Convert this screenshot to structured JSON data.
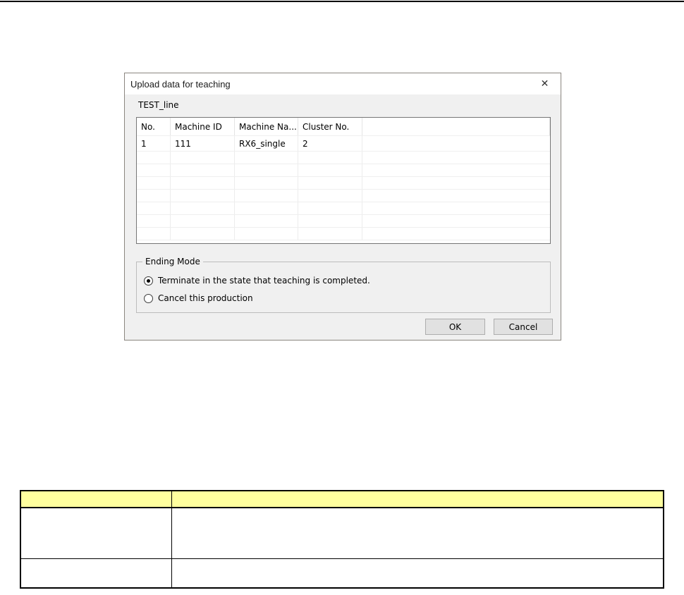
{
  "dialog": {
    "title": "Upload data for teaching",
    "close_icon": "✕",
    "line_name": "TEST_line",
    "machine_table": {
      "columns": [
        "No.",
        "Machine ID",
        "Machine Na...",
        "Cluster No.",
        ""
      ],
      "rows": [
        [
          "1",
          "111",
          "RX6_single",
          "2",
          ""
        ]
      ],
      "empty_row_count": 7
    },
    "ending_mode": {
      "legend": "Ending Mode",
      "options": [
        {
          "label": "Terminate in the state that teaching is completed.",
          "selected": true
        },
        {
          "label": "Cancel this production",
          "selected": false
        }
      ]
    },
    "ok_label": "OK",
    "cancel_label": "Cancel"
  },
  "doc_table": {
    "header": [
      "",
      ""
    ],
    "rows": [
      [
        "",
        ""
      ],
      [
        "",
        ""
      ]
    ],
    "header_bg": "#ffff9e"
  },
  "colors": {
    "dialog_bg": "#f0f0f0",
    "titlebar_bg": "#ffffff",
    "dialog_border": "#8b8680",
    "button_bg": "#e1e1e1",
    "button_border": "#adadad",
    "grid_line": "#ececec",
    "list_border": "#767676",
    "doc_table_border": "#000000",
    "page_top_rule": "#000000"
  }
}
